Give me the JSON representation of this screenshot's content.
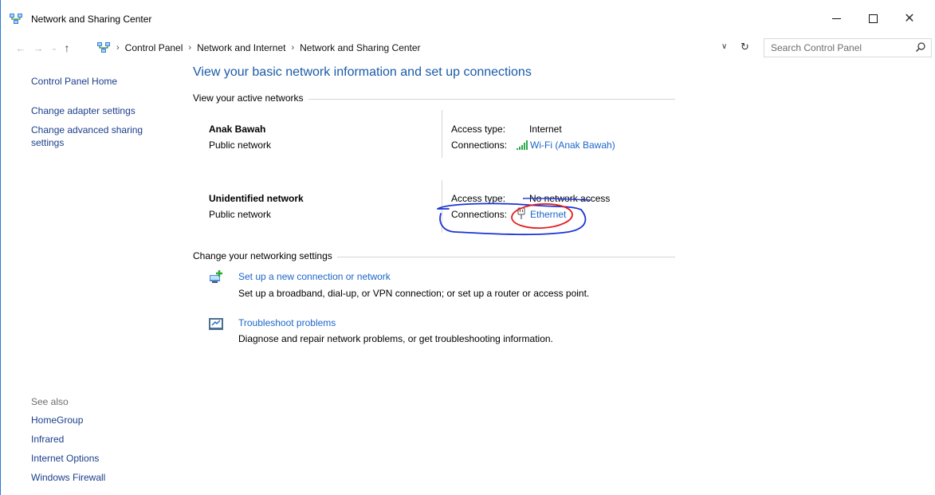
{
  "window": {
    "title": "Network and Sharing Center",
    "icon": "network-center-icon"
  },
  "nav": {
    "breadcrumb": [
      "Control Panel",
      "Network and Internet",
      "Network and Sharing Center"
    ],
    "search_placeholder": "Search Control Panel"
  },
  "sidebar": {
    "home": "Control Panel Home",
    "adapter": "Change adapter settings",
    "sharing_line1": "Change advanced sharing",
    "sharing_line2": "settings",
    "see_also": "See also",
    "see_also_links": [
      "HomeGroup",
      "Infrared",
      "Internet Options",
      "Windows Firewall"
    ]
  },
  "main": {
    "title": "View your basic network information and set up connections",
    "active_networks_label": "View your active networks",
    "networks": [
      {
        "name": "Anak Bawah",
        "category": "Public network",
        "access_label": "Access type:",
        "access_value": "Internet",
        "connections_label": "Connections:",
        "connection": "Wi-Fi (Anak Bawah)",
        "connection_icon": "wifi-signal-icon"
      },
      {
        "name": "Unidentified network",
        "category": "Public network",
        "access_label": "Access type:",
        "access_value": "No network access",
        "connections_label": "Connections:",
        "connection": "Ethernet",
        "connection_icon": "ethernet-icon"
      }
    ],
    "change_settings_label": "Change your networking settings",
    "tasks": [
      {
        "link": "Set up a new connection or network",
        "description": "Set up a broadband, dial-up, or VPN connection; or set up a router or access point.",
        "icon": "new-connection-icon"
      },
      {
        "link": "Troubleshoot problems",
        "description": "Diagnose and repair network problems, or get troubleshooting information.",
        "icon": "troubleshoot-icon"
      }
    ]
  },
  "colors": {
    "link": "#1b66c9",
    "sidebar_link": "#1b3e8c",
    "title": "#1a5aa8",
    "annotation_blue": "#1a35d6",
    "annotation_red": "#e21c1c"
  }
}
